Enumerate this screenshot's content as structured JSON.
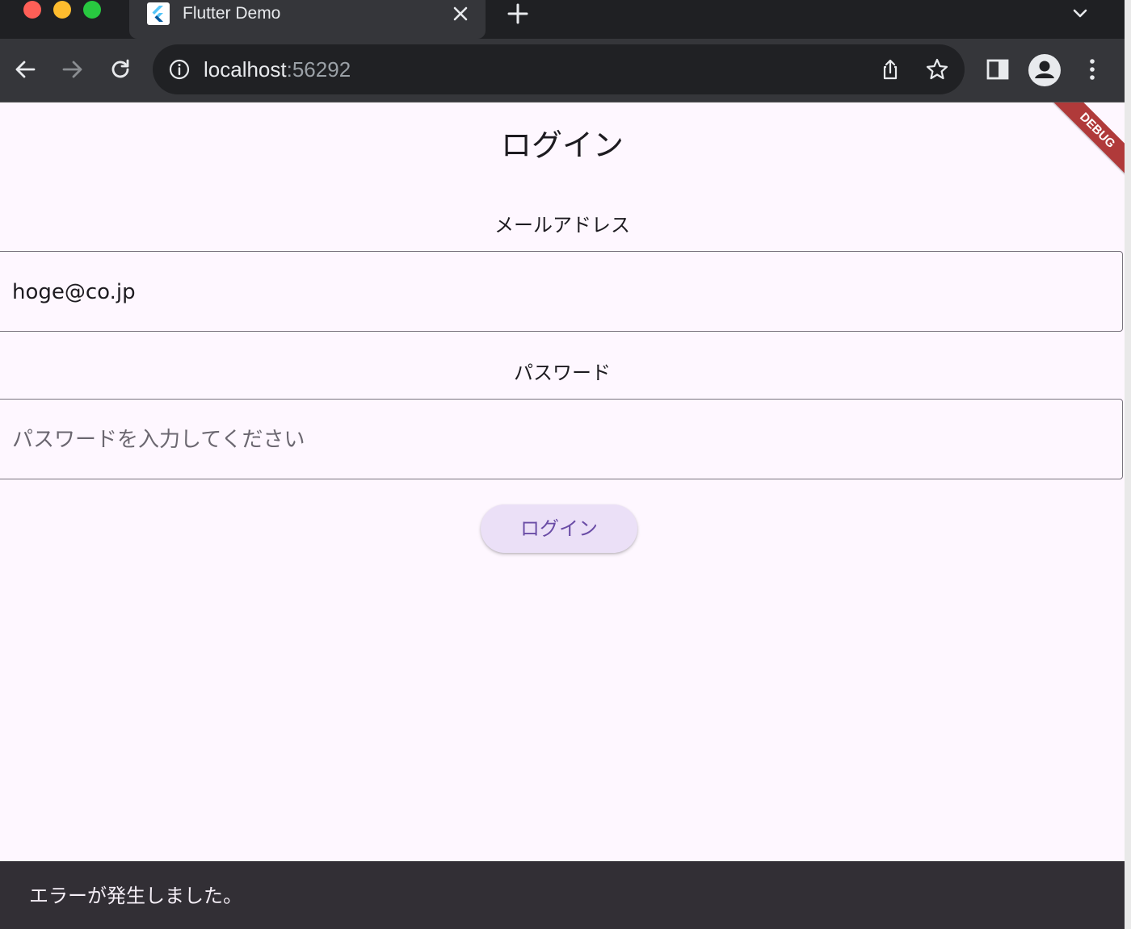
{
  "browser": {
    "tab": {
      "title": "Flutter Demo",
      "favicon": "flutter-logo"
    },
    "url": {
      "host": "localhost",
      "port": ":56292"
    },
    "icons": [
      "back-icon",
      "forward-icon",
      "reload-icon",
      "info-icon",
      "share-icon",
      "star-icon",
      "side-panel-icon",
      "profile-icon",
      "more-icon",
      "close-icon",
      "plus-icon",
      "chevron-down-icon"
    ]
  },
  "page": {
    "title": "ログイン",
    "email": {
      "label": "メールアドレス",
      "value": "hoge@co.jp"
    },
    "password": {
      "label": "パスワード",
      "placeholder": "パスワードを入力してください"
    },
    "login_button": "ログイン",
    "debug_banner": "DEBUG"
  },
  "snackbar": {
    "message": "エラーが発生しました。"
  },
  "colors": {
    "background": "#fef7ff",
    "button_bg": "#ebe0f7",
    "button_text": "#6a4ca6",
    "snackbar_bg": "#322f35",
    "debug_banner": "#b03a3a"
  }
}
